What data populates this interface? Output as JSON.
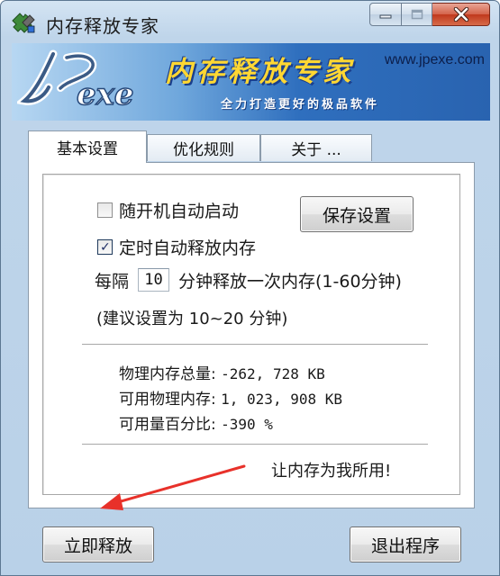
{
  "window": {
    "title": "内存释放专家"
  },
  "banner": {
    "logo_text": "JPexe",
    "title": "内存释放专家",
    "url": "www.jpexe.com",
    "slogan": "全力打造更好的极品软件"
  },
  "tabs": [
    {
      "label": "基本设置",
      "active": true
    },
    {
      "label": "优化规则",
      "active": false
    },
    {
      "label": "关于 ...",
      "active": false
    }
  ],
  "settings": {
    "autostart_label": "随开机自动启动",
    "autostart_checked": false,
    "timed_release_label": "定时自动释放内存",
    "timed_release_checked": true,
    "interval_prefix": "每隔",
    "interval_value": "10",
    "interval_suffix": "分钟释放一次内存(1-60分钟)",
    "suggestion": "(建议设置为 10~20 分钟)",
    "save_button": "保存设置"
  },
  "stats": [
    {
      "label": "物理内存总量:",
      "value": "-262, 728 KB"
    },
    {
      "label": "可用物理内存:",
      "value": "1, 023, 908 KB"
    },
    {
      "label": "可用量百分比:",
      "value": "-390 %"
    }
  ],
  "slogan_bottom": "让内存为我所用!",
  "buttons": {
    "release_now": "立即释放",
    "exit": "退出程序"
  },
  "colors": {
    "banner_title": "#ffd733",
    "annotation_arrow": "#e8312a",
    "close_button": "#c9442a"
  },
  "icons": {
    "app": "puzzle-icon",
    "minimize": "minimize-icon",
    "maximize": "maximize-icon",
    "close": "close-icon",
    "check": "checkmark-icon",
    "annotation": "red-arrow-icon"
  }
}
